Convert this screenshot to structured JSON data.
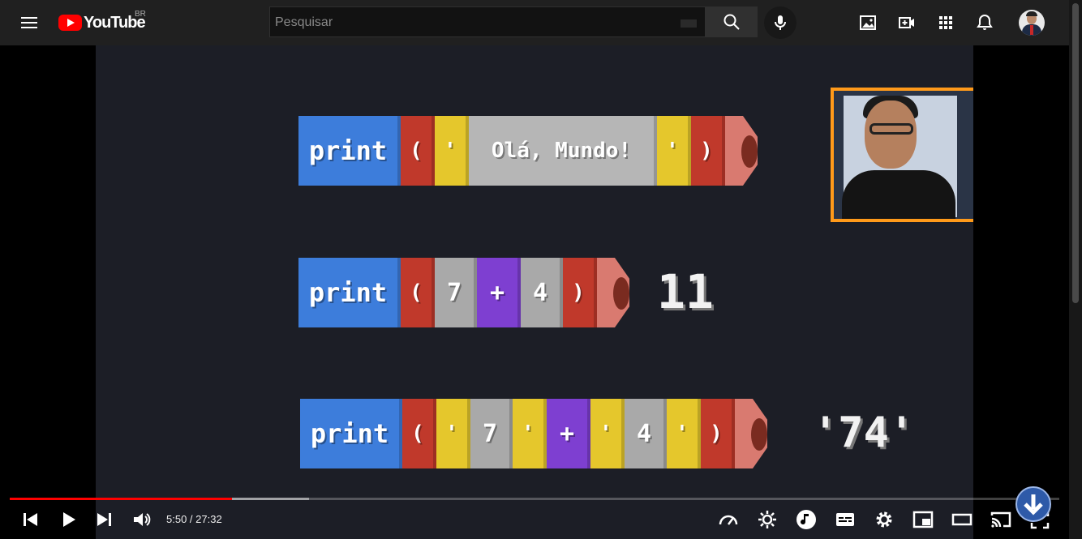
{
  "header": {
    "logo_text": "YouTube",
    "country_code": "BR",
    "search_placeholder": "Pesquisar",
    "icons": [
      "menu-icon",
      "search-icon",
      "keyboard-icon",
      "mic-icon",
      "image-icon",
      "create-video-icon",
      "apps-grid-icon",
      "bell-icon",
      "avatar"
    ]
  },
  "video": {
    "rows": [
      {
        "blocks": [
          "print",
          "(",
          "'",
          "Olá, Mundo!",
          "'",
          ")"
        ],
        "output": ""
      },
      {
        "blocks": [
          "print",
          "(",
          "7",
          "+",
          "4",
          ")"
        ],
        "output": "11"
      },
      {
        "blocks": [
          "print",
          "(",
          "'",
          "7",
          "'",
          "+",
          "'",
          "4",
          "'",
          ")"
        ],
        "output": "'74'"
      }
    ]
  },
  "player": {
    "current_time": "5:50",
    "duration": "27:32",
    "time_display": "5:50 / 27:32",
    "played_fraction": 0.212,
    "loaded_fraction": 0.285,
    "accent_color": "#ff0000"
  }
}
